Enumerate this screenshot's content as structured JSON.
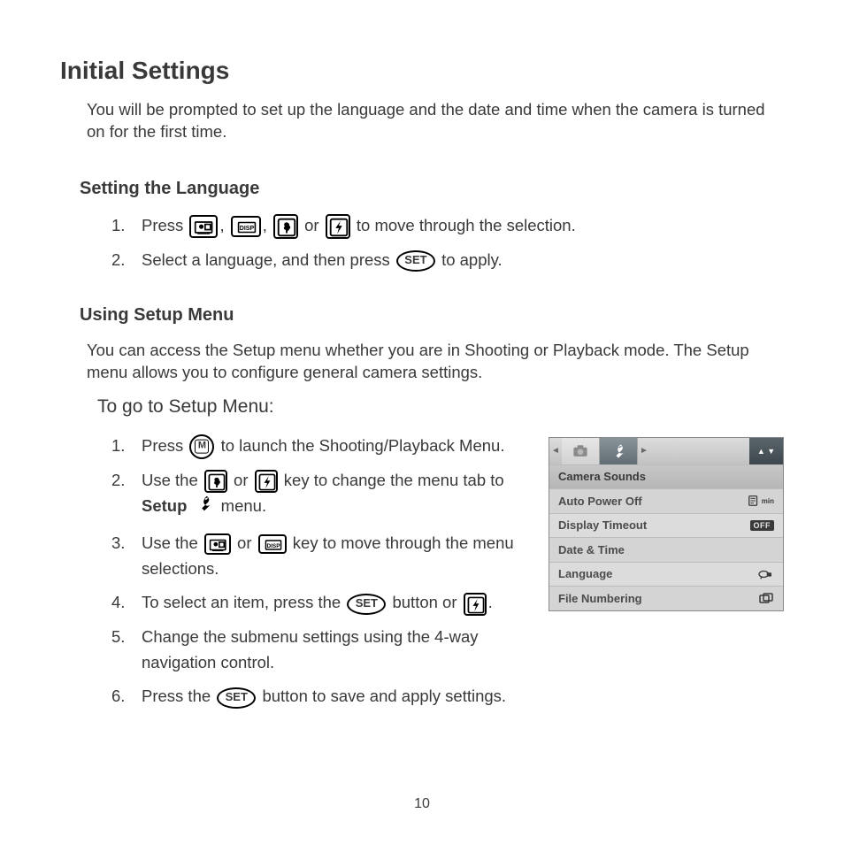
{
  "title": "Initial Settings",
  "intro": "You will be prompted to set up the language and the date and time when the camera is turned on for the first time.",
  "section_language": {
    "heading": "Setting the Language",
    "step1_a": "Press ",
    "step1_b": " or ",
    "step1_c": " to move through the selection.",
    "step2_a": "Select a language, and then press ",
    "step2_b": " to apply."
  },
  "section_setup": {
    "heading": "Using Setup Menu",
    "intro": "You can access the Setup menu whether you are in Shooting or Playback mode. The Setup menu allows you to configure general camera settings.",
    "goto": "To go to Setup Menu:",
    "step1_a": "Press ",
    "step1_b": " to launch the Shooting/Playback Menu.",
    "step2_a": "Use the ",
    "step2_b": " or ",
    "step2_c": " key to change the menu tab to ",
    "step2_setup": "Setup",
    "step2_d": " menu.",
    "step3_a": "Use the ",
    "step3_b": " or ",
    "step3_c": " key to move through the menu selections.",
    "step4_a": "To select an item, press the ",
    "step4_b": " button or ",
    "step4_c": ".",
    "step5": "Change the submenu settings using the 4-way navigation control.",
    "step6_a": "Press the ",
    "step6_b": " button to save and apply settings."
  },
  "icons": {
    "set": "SET",
    "disp": "DISP"
  },
  "menu_shot": {
    "rows": [
      {
        "label": "Camera Sounds",
        "value": ""
      },
      {
        "label": "Auto Power Off",
        "value": "min",
        "icon": "doc"
      },
      {
        "label": "Display Timeout",
        "value": "OFF",
        "chip": true
      },
      {
        "label": "Date & Time",
        "value": ""
      },
      {
        "label": "Language",
        "value": "",
        "icon": "lang"
      },
      {
        "label": "File Numbering",
        "value": "",
        "icon": "filenum"
      }
    ]
  },
  "page_number": "10"
}
